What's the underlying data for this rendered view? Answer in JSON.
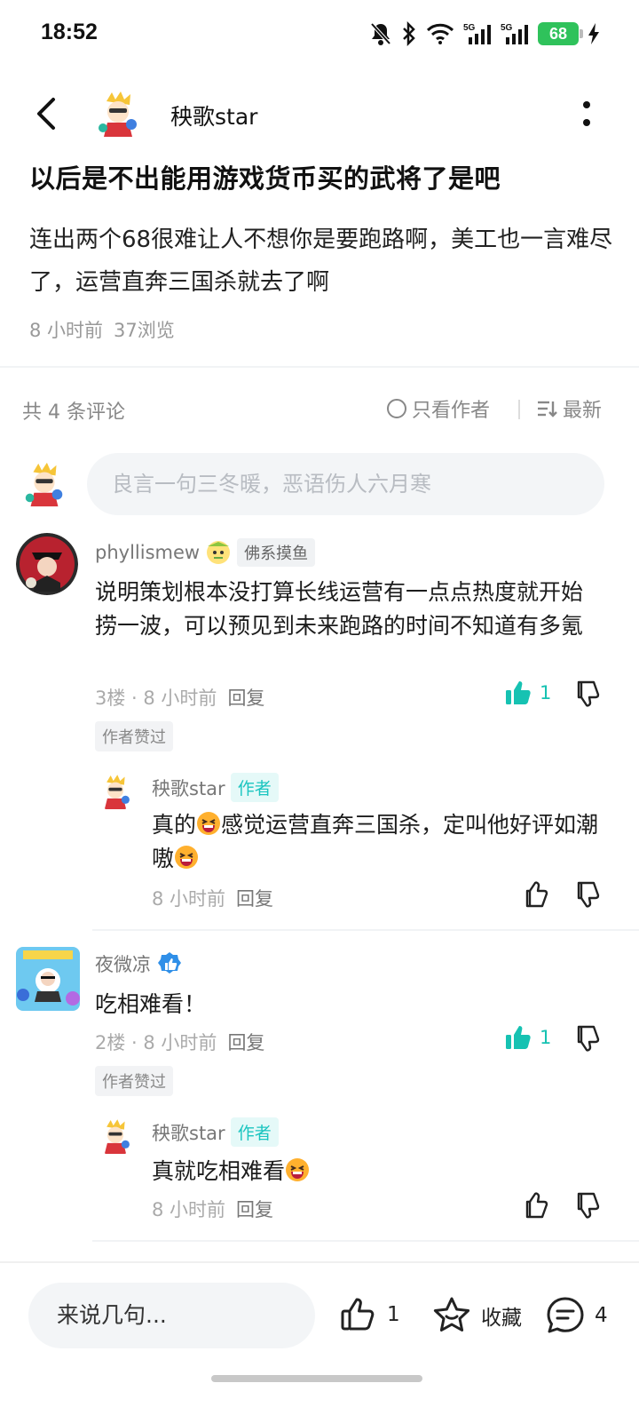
{
  "status_bar": {
    "time": "18:52",
    "battery": "68"
  },
  "header": {
    "author_name": "秧歌star"
  },
  "post": {
    "title": "以后是不出能用游戏货币买的武将了是吧",
    "body": "连出两个68很难让人不想你是要跑路啊，美工也一言难尽了，运营直奔三国杀就去了啊",
    "time": "8 小时前",
    "views": "37浏览"
  },
  "comments_bar": {
    "count_label": "共 4 条评论",
    "author_only_label": "只看作者",
    "sort_label": "最新"
  },
  "comment_input": {
    "placeholder": "良言一句三冬暖，恶语伤人六月寒"
  },
  "comments": [
    {
      "name": "phyllismew",
      "tag": "佛系摸鱼",
      "text": "说明策划根本没打算长线运营有一点点热度就开始捞一波，可以预见到未来跑路的时间不知道有多氪",
      "meta": "3楼 · 8 小时前",
      "reply_label": "回复",
      "likes": "1",
      "liked_label": "作者赞过",
      "reply": {
        "name": "秧歌star",
        "author_tag": "作者",
        "text_a": "真的",
        "text_b": "感觉运营直奔三国杀，定叫他好评如潮嗷",
        "meta": "8 小时前",
        "reply_label": "回复"
      }
    },
    {
      "name": "夜微凉",
      "text": "吃相难看！",
      "meta": "2楼 · 8 小时前",
      "reply_label": "回复",
      "likes": "1",
      "liked_label": "作者赞过",
      "reply": {
        "name": "秧歌star",
        "author_tag": "作者",
        "text": "真就吃相难看",
        "meta": "8 小时前",
        "reply_label": "回复"
      }
    }
  ],
  "bottom_bar": {
    "input_placeholder": "来说几句...",
    "like_count": "1",
    "favorite_label": "收藏",
    "comment_count": "4"
  },
  "colors": {
    "accent": "#16c2b2",
    "battery": "#2fc25b",
    "muted": "#999999"
  }
}
